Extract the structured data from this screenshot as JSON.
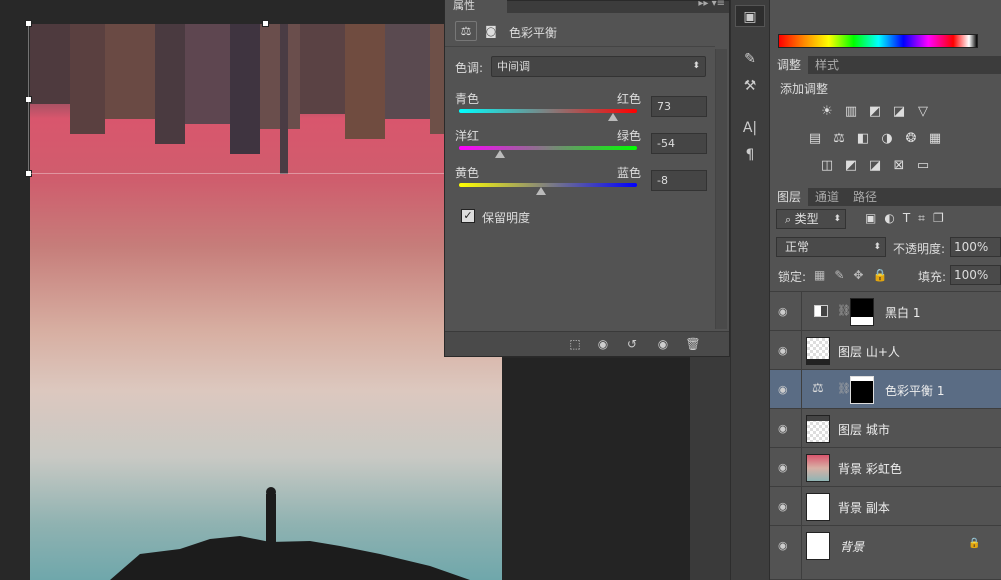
{
  "properties_panel": {
    "tab_title": "属性",
    "adjustment_name": "色彩平衡",
    "tone_label": "色调:",
    "tone_value": "中间调",
    "sliders": [
      {
        "left": "青色",
        "right": "红色",
        "value": "73",
        "level": 0.865
      },
      {
        "left": "洋红",
        "right": "绿色",
        "value": "-54",
        "level": 0.23
      },
      {
        "left": "黄色",
        "right": "蓝色",
        "value": "-8",
        "level": 0.46
      }
    ],
    "preserve_luminosity": "保留明度"
  },
  "adjustments_panel": {
    "tabs": [
      "调整",
      "样式"
    ],
    "title": "添加调整"
  },
  "layers_panel": {
    "tabs": [
      "图层",
      "通道",
      "路径"
    ],
    "filter_label": "类型",
    "blend_mode": "正常",
    "opacity_label": "不透明度:",
    "opacity_value": "100%",
    "lock_label": "锁定:",
    "fill_label": "填充:",
    "fill_value": "100%",
    "layers": [
      {
        "name": "黑白 1",
        "selected": false
      },
      {
        "name": "图层 山+人",
        "selected": false
      },
      {
        "name": "色彩平衡 1",
        "selected": true
      },
      {
        "name": "图层 城市",
        "selected": false
      },
      {
        "name": "背景 彩虹色",
        "selected": false
      },
      {
        "name": "背景 副本",
        "selected": false
      },
      {
        "name": "背景",
        "selected": false
      }
    ]
  },
  "colors": {
    "panel_bg": "#535353",
    "selected_layer": "#5a6c84"
  }
}
